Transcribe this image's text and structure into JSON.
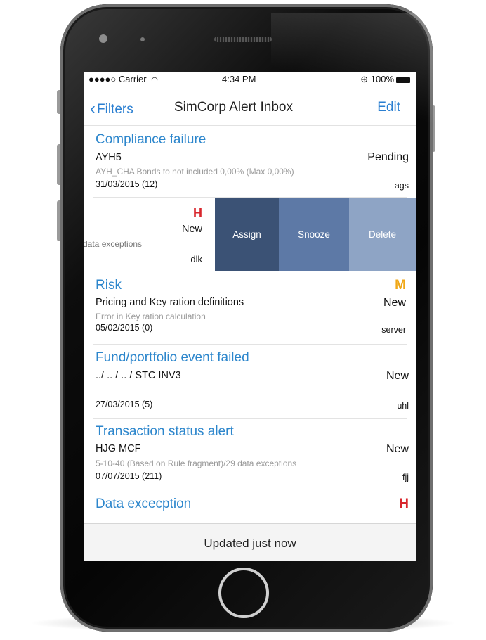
{
  "status_bar": {
    "carrier": "●●●●○ Carrier",
    "wifi": "wifi-icon",
    "time": "4:34 PM",
    "battery": "100%"
  },
  "nav": {
    "back_label": "Filters",
    "title": "SimCorp Alert Inbox",
    "edit_label": "Edit"
  },
  "alerts": [
    {
      "title": "Compliance failure",
      "line": "AYH5",
      "status": "Pending",
      "detail": "AYH_CHA Bonds to not included 0,00% (Max 0,00%)",
      "date": "31/03/2015 (12)",
      "user": "ags"
    },
    {
      "priority": "H",
      "status": "New",
      "detail": "data exceptions",
      "user": "dlk"
    },
    {
      "title": "Risk",
      "priority": "M",
      "line": "Pricing and Key ration definitions",
      "status": "New",
      "detail": "Error in Key ration calculation",
      "date": "05/02/2015 (0) -",
      "user": "server"
    },
    {
      "title": "Fund/portfolio event failed",
      "line": "../ .. / .. / STC INV3",
      "status": "New",
      "date": "27/03/2015 (5)",
      "user": "uhl"
    },
    {
      "title": "Transaction status alert",
      "line": "HJG MCF",
      "status": "New",
      "detail": "5-10-40 (Based on Rule fragment)/29 data exceptions",
      "date": "07/07/2015 (211)",
      "user": "fjj"
    },
    {
      "title": "Data excecption",
      "priority": "H"
    }
  ],
  "swipe_actions": {
    "assign": "Assign",
    "snooze": "Snooze",
    "delete": "Delete"
  },
  "footer": {
    "updated": "Updated just now"
  },
  "colors": {
    "link": "#2b7fd1",
    "title": "#2c86cc",
    "priority_high": "#d8262c",
    "priority_medium": "#f0a818",
    "assign": "#3b5275",
    "snooze": "#5d79a6",
    "delete": "#8ea4c5"
  }
}
